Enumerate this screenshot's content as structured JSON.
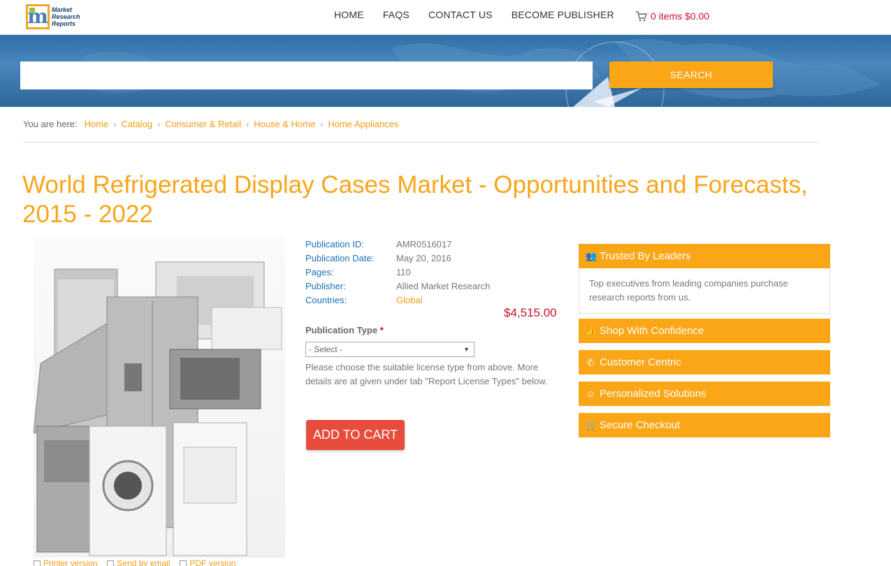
{
  "header": {
    "logo_text": [
      "Market",
      "Research",
      "Reports"
    ],
    "logo_letter": "m",
    "nav": [
      "HOME",
      "FAQS",
      "CONTACT US",
      "BECOME PUBLISHER"
    ],
    "cart": "0 items $0.00"
  },
  "search": {
    "placeholder": "",
    "button": "SEARCH"
  },
  "breadcrumb": {
    "lead": "You are here:",
    "items": [
      "Home",
      "Catalog",
      "Consumer & Retail",
      "House & Home",
      "Home Appliances"
    ]
  },
  "title": "World Refrigerated Display Cases Market - Opportunities and Forecasts, 2015 - 2022",
  "details": {
    "rows": [
      {
        "k": "Publication ID:",
        "v": "AMR0516017"
      },
      {
        "k": "Publication Date:",
        "v": "May 20, 2016"
      },
      {
        "k": "Pages:",
        "v": "110"
      },
      {
        "k": "Publisher:",
        "v": "Allied Market Research"
      },
      {
        "k": "Countries:",
        "v": "Global"
      }
    ],
    "price": "$4,515.00",
    "ptype_label": "Publication Type",
    "ptype_required": "*",
    "select_value": "- Select -",
    "help": "Please choose the suitable license type from above. More details are at given under tab \"Report License Types\" below.",
    "add_to_cart": "ADD TO CART"
  },
  "file_links": [
    "Printer version",
    "Send by email",
    "PDF version"
  ],
  "sidebar": {
    "trusted": {
      "title": "Trusted By Leaders",
      "body": "Top executives from leading companies purchase research reports from us."
    },
    "items": [
      "Shop With Confidence",
      "Customer Centric",
      "Personalized Solutions",
      "Secure Checkout"
    ]
  },
  "colors": {
    "accent": "#fba617",
    "price": "#c8102e",
    "link": "#1a6fb5",
    "cart_button": "#e84c3d"
  }
}
